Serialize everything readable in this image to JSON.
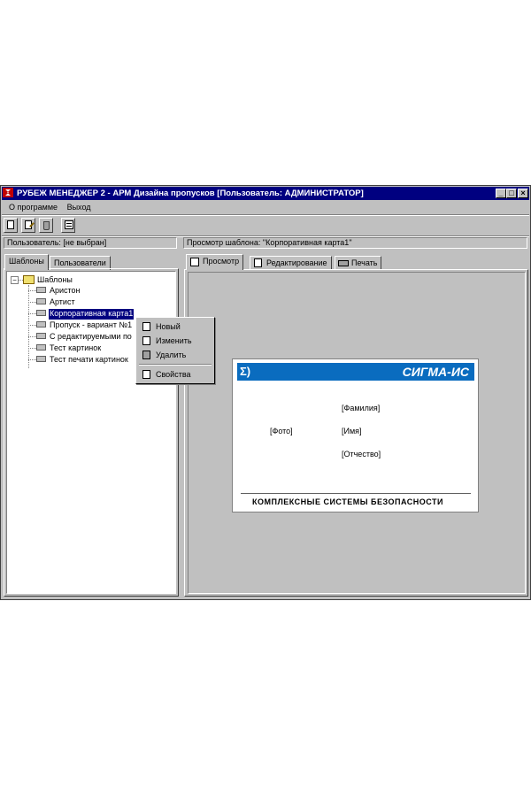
{
  "window": {
    "title": "РУБЕЖ МЕНЕДЖЕР 2 - АРМ Дизайна пропусков [Пользователь: АДМИНИСТРАТОР]",
    "controls": {
      "minimize": "_",
      "maximize": "□",
      "close": "×"
    }
  },
  "menu": {
    "items": [
      "О программе",
      "Выход"
    ]
  },
  "toolbar": {
    "buttons": [
      "new-document-icon",
      "edit-document-icon",
      "delete-trash-icon",
      "properties-icon"
    ]
  },
  "status": {
    "user_label": "Пользователь: [не выбран]",
    "preview_label": "Просмотр шаблона: \"Корпоративная карта1\""
  },
  "left_tabs": [
    "Шаблоны",
    "Пользователи"
  ],
  "tree": {
    "root": "Шаблоны",
    "expander": "−",
    "items": [
      "Аристон",
      "Артист",
      "Корпоративная карта1",
      "Пропуск - вариант №1",
      "С редактируемыми по",
      "Тест картинок",
      "Тест печати картинок"
    ],
    "selected_index": 2
  },
  "context_menu": {
    "items": [
      "Новый",
      "Изменить",
      "Удалить",
      "Свойства"
    ]
  },
  "right_tabs": [
    "Просмотр",
    "Редактирование",
    "Печать"
  ],
  "card": {
    "logo": "Σ)",
    "brand": "СИГМА-ИС",
    "photo": "[Фото]",
    "surname": "[Фамилия]",
    "name": "[Имя]",
    "patronymic": "[Отчество]",
    "slogan": "КОМПЛЕКСНЫЕ СИСТЕМЫ БЕЗОПАСНОСТИ"
  },
  "colors": {
    "titlebar": "#000080",
    "selection": "#000080",
    "card_band": "#0a6cbf",
    "app_icon": "#c00000"
  }
}
